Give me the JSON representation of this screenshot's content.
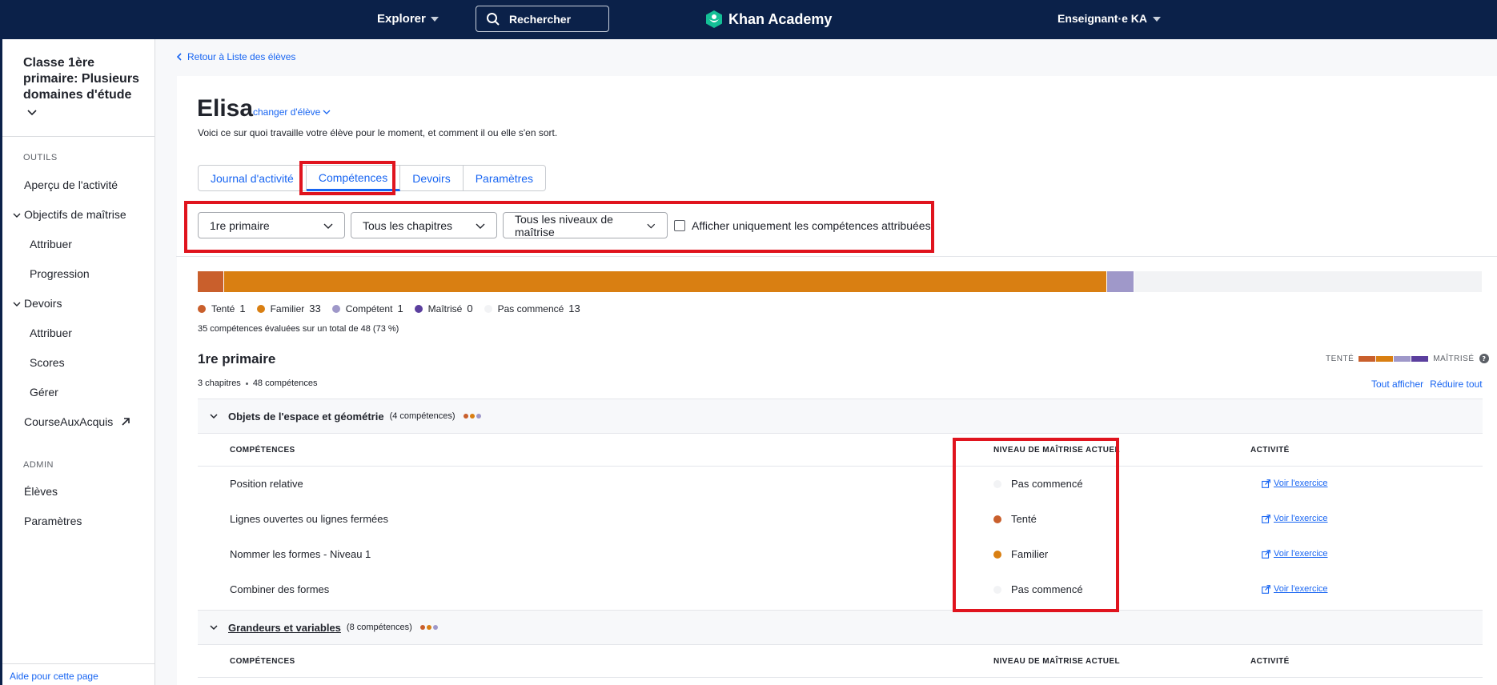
{
  "topbar": {
    "explore_label": "Explorer",
    "search_label": "Rechercher",
    "brand_name": "Khan Academy",
    "account_label": "Enseignant·e KA"
  },
  "sidebar": {
    "class_title": "Classe 1ère primaire: Plusieurs domaines d'étude",
    "tools_label": "OUTILS",
    "admin_label": "ADMIN",
    "items": {
      "activity": "Aperçu de l'activité",
      "mastery_goals": "Objectifs de maîtrise",
      "mastery_assign": "Attribuer",
      "mastery_progress": "Progression",
      "assignments": "Devoirs",
      "assignments_assign": "Attribuer",
      "scores": "Scores",
      "manage": "Gérer",
      "course_challenge": "CourseAuxAcquis",
      "students": "Élèves",
      "settings": "Paramètres"
    },
    "help_label": "Aide pour cette page"
  },
  "main": {
    "back_link": "Retour à Liste des élèves",
    "student_name": "Elisa",
    "change_student": "changer d'élève",
    "subtitle": "Voici ce sur quoi travaille votre élève pour le moment, et comment il ou elle s'en sort.",
    "tabs": [
      "Journal d'activité",
      "Compétences",
      "Devoirs",
      "Paramètres"
    ],
    "active_tab": "Compétences",
    "filters": {
      "grade": "1re primaire",
      "chapters": "Tous les chapitres",
      "levels": "Tous les niveaux de maîtrise",
      "assigned_only": "Afficher uniquement les compétences attribuées",
      "assigned_only_checked": false
    },
    "progress": {
      "total": 48,
      "segments": [
        {
          "key": "attempted",
          "count": 1,
          "color": "#c95f2c"
        },
        {
          "key": "familiar",
          "count": 33,
          "color": "#d97f12"
        },
        {
          "key": "proficient",
          "count": 1,
          "color": "#9f98c9"
        },
        {
          "key": "mastered",
          "count": 0,
          "color": "#5b3f9e"
        }
      ]
    },
    "legend": [
      {
        "label": "Tenté",
        "count": "1",
        "color": "#c95f2c"
      },
      {
        "label": "Familier",
        "count": "33",
        "color": "#d97f12"
      },
      {
        "label": "Compétent",
        "count": "1",
        "color": "#9f98c9"
      },
      {
        "label": "Maîtrisé",
        "count": "0",
        "color": "#5b3f9e"
      },
      {
        "label": "Pas commencé",
        "count": "13",
        "color": "#f2f3f5"
      }
    ],
    "evaluated_text": "35 compétences évaluées sur un total de 48 (73 %)",
    "grade_title": "1re primaire",
    "grade_chapters": "3 chapitres",
    "grade_skills": "48 compétences",
    "scale_low": "TENTÉ",
    "scale_high": "MAÎTRISÉ",
    "scale_colors": [
      "#c95f2c",
      "#d97f12",
      "#9f98c9",
      "#5b3f9e"
    ],
    "show_all": "Tout afficher",
    "collapse_all": "Réduire tout",
    "columns": {
      "skills": "COMPÉTENCES",
      "level": "NIVEAU DE MAÎTRISE ACTUEL",
      "activity": "ACTIVITÉ"
    },
    "units": [
      {
        "title": "Objets de l'espace et géométrie",
        "count": "(4 compétences)",
        "skills": [
          {
            "name": "Position relative",
            "level": "Pas commencé",
            "color": "#f2f3f5",
            "link": "Voir l'exercice"
          },
          {
            "name": "Lignes ouvertes ou lignes fermées",
            "level": "Tenté",
            "color": "#c95f2c",
            "link": "Voir l'exercice"
          },
          {
            "name": "Nommer les formes - Niveau 1",
            "level": "Familier",
            "color": "#d97f12",
            "link": "Voir l'exercice"
          },
          {
            "name": "Combiner des formes",
            "level": "Pas commencé",
            "color": "#f2f3f5",
            "link": "Voir l'exercice"
          }
        ]
      },
      {
        "title": "Grandeurs et variables",
        "count": "(8 compétences)",
        "skills": []
      }
    ]
  }
}
